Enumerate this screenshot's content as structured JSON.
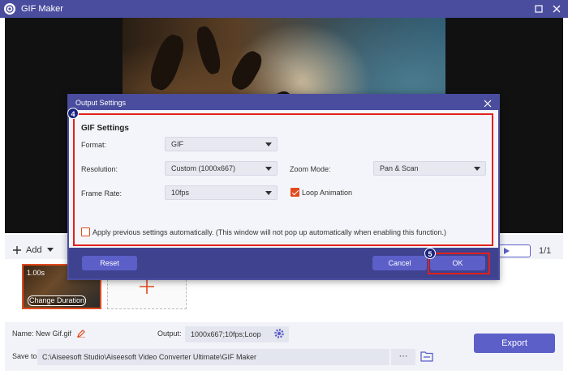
{
  "window": {
    "title": "GIF Maker"
  },
  "toolbar": {
    "add_label": "Add",
    "page_count": "1/1"
  },
  "clip": {
    "duration": "1.00s",
    "change_duration_label": "Change Duration"
  },
  "bottom": {
    "name_label": "Name:",
    "name_value": "New Gif.gif",
    "output_label": "Output:",
    "output_value": "1000x667;10fps;Loop",
    "saveto_label": "Save to:",
    "saveto_value": "C:\\Aiseesoft Studio\\Aiseesoft Video Converter Ultimate\\GIF Maker",
    "dots_label": "···",
    "export_label": "Export"
  },
  "dialog": {
    "title": "Output Settings",
    "section_title": "GIF Settings",
    "format_label": "Format:",
    "format_value": "GIF",
    "resolution_label": "Resolution:",
    "resolution_value": "Custom (1000x667)",
    "zoom_label": "Zoom Mode:",
    "zoom_value": "Pan & Scan",
    "framerate_label": "Frame Rate:",
    "framerate_value": "10fps",
    "loop_label": "Loop Animation",
    "loop_checked": true,
    "apply_label": "Apply previous settings automatically. (This window will not pop up automatically when enabling this function.)",
    "apply_checked": false,
    "reset_label": "Reset",
    "cancel_label": "Cancel",
    "ok_label": "OK"
  },
  "annotations": {
    "marker_settings": "4",
    "marker_ok": "5"
  },
  "colors": {
    "brand": "#4a4d9e",
    "accent": "#5b5fc7",
    "highlight": "#e0201e",
    "checkbox": "#e24a1e"
  }
}
